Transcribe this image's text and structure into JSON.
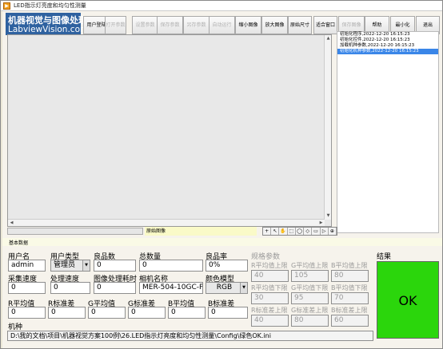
{
  "window": {
    "title": "LED指示灯亮度和均匀性测量"
  },
  "logo": {
    "line1": "机器视觉与图像处理",
    "line2": "LabviewVision.com"
  },
  "toolbar": [
    {
      "label": "用户登陆",
      "enabled": true
    },
    {
      "label": "打开参数",
      "enabled": false
    },
    {
      "label": "设置参数",
      "enabled": false
    },
    {
      "label": "保存参数",
      "enabled": false
    },
    {
      "label": "另存参数",
      "enabled": false
    },
    {
      "label": "自动运行",
      "enabled": false
    },
    {
      "label": "缩小图像",
      "enabled": true
    },
    {
      "label": "放大图像",
      "enabled": true
    },
    {
      "label": "原始尺寸",
      "enabled": true
    },
    {
      "label": "适合窗口",
      "enabled": true
    },
    {
      "label": "保存图像",
      "enabled": false
    },
    {
      "label": "帮助",
      "enabled": true
    },
    {
      "label": "最小化",
      "enabled": true
    },
    {
      "label": "退出",
      "enabled": true
    }
  ],
  "log": [
    {
      "text": "初始化程序,2022-12-20 16:15:23",
      "selected": false
    },
    {
      "text": "初始化控件,2022-12-20 16:15:23",
      "selected": false
    },
    {
      "text": "加载机种参数,2022-12-20 16:15:23",
      "selected": false
    },
    {
      "text": "初始化机种参数,2022-12-20 16:15:23",
      "selected": true
    }
  ],
  "image_tag": "原始图像",
  "tools": [
    "+",
    "↖",
    "✋",
    "⬚",
    "◯",
    "◇",
    "▭",
    "▷",
    "⊕"
  ],
  "section": {
    "title": "基本数据"
  },
  "fields": {
    "user_name": {
      "label": "用户名",
      "value": "admin"
    },
    "user_type": {
      "label": "用户类型",
      "value": "管理员"
    },
    "good_count": {
      "label": "良品数",
      "value": "0"
    },
    "total_count": {
      "label": "总数量",
      "value": "0"
    },
    "yield": {
      "label": "良品率",
      "value": "0%"
    },
    "capture_speed": {
      "label": "采集速度",
      "value": "0"
    },
    "process_speed": {
      "label": "处理速度",
      "value": "0"
    },
    "process_time": {
      "label": "图像处理耗时",
      "value": "0"
    },
    "camera_name": {
      "label": "相机名称",
      "value": "MER-504-10GC-P"
    },
    "color_model": {
      "label": "颜色模型",
      "value": "RGB"
    },
    "r_mean": {
      "label": "R平均值",
      "value": "0"
    },
    "r_std": {
      "label": "R标准差",
      "value": "0"
    },
    "g_mean": {
      "label": "G平均值",
      "value": "0"
    },
    "g_std": {
      "label": "G标准差",
      "value": "0"
    },
    "b_mean": {
      "label": "B平均值",
      "value": "0"
    },
    "b_std": {
      "label": "B标准差",
      "value": "0"
    }
  },
  "spec": {
    "title": "规格参数",
    "rows": [
      [
        {
          "label": "R平均值上限",
          "value": "40"
        },
        {
          "label": "G平均值上限",
          "value": "105"
        },
        {
          "label": "B平均值上限",
          "value": "80"
        }
      ],
      [
        {
          "label": "R平均值下限",
          "value": "30"
        },
        {
          "label": "G平均值下限",
          "value": "95"
        },
        {
          "label": "B平均值下限",
          "value": "70"
        }
      ],
      [
        {
          "label": "R标准差上限",
          "value": "40"
        },
        {
          "label": "G标准差上限",
          "value": "80"
        },
        {
          "label": "B标准差上限",
          "value": "60"
        }
      ]
    ]
  },
  "result": {
    "title": "结果",
    "value": "OK",
    "color": "#2bd60c"
  },
  "machine": {
    "label": "机种",
    "path": "D:\\我的文档\\项目\\机器视觉方案100例\\26.LED指示灯亮度和均匀性测量\\Config\\绿色OK.ini"
  }
}
